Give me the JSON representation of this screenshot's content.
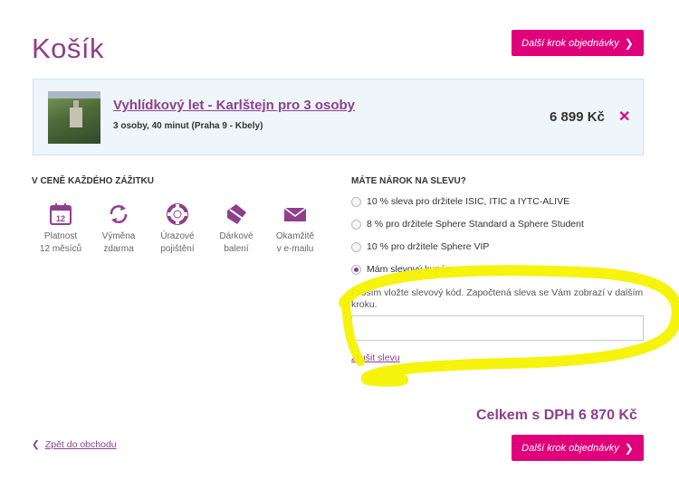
{
  "page": {
    "title": "Košík"
  },
  "actions": {
    "next_label": "Další krok objednávky",
    "next_chevron": "❯",
    "back_chevron": "❮",
    "back_label": "Zpět do obchodu"
  },
  "item": {
    "title": "Vyhlídkový let - Karlštejn pro 3 osoby",
    "subtitle": "3 osoby, 40 minut  (Praha 9 - Kbely)",
    "price": "6 899 Kč",
    "remove": "✕"
  },
  "benefits": {
    "heading": "V CENĚ KAŽDÉHO ZÁŽITKU",
    "items": [
      {
        "icon": "calendar-icon",
        "calendar_number": "12",
        "line1": "Platnost",
        "line2": "12 měsíců"
      },
      {
        "icon": "exchange-icon",
        "line1": "Výměna",
        "line2": "zdarma"
      },
      {
        "icon": "lifebuoy-icon",
        "line1": "Úrazové",
        "line2": "pojištění"
      },
      {
        "icon": "gift-box-icon",
        "line1": "Dárkové",
        "line2": "balení"
      },
      {
        "icon": "envelope-icon",
        "line1": "Okamžitě",
        "line2": "v e-mailu"
      }
    ]
  },
  "discount": {
    "heading": "MÁTE NÁROK NA SLEVU?",
    "options": [
      {
        "label": "10 % sleva pro držitele ISIC, ITIC a IYTC-ALIVE",
        "selected": false
      },
      {
        "label": "8 % pro držitele Sphere Standard a Sphere Student",
        "selected": false
      },
      {
        "label": "10 % pro držitele Sphere VIP",
        "selected": false
      },
      {
        "label": "Mám slevový kupón",
        "selected": true
      }
    ],
    "coupon_hint": "Prosím vložte slevový kód. Započtená sleva se Vám zobrazí v dalším kroku.",
    "coupon_value": "",
    "cancel_label": "Zrušit slevu"
  },
  "summary": {
    "total": "Celkem s DPH 6 870 Kč"
  },
  "colors": {
    "accent": "#8f3f8c",
    "cta": "#e0007a",
    "highlight": "#f5f200"
  }
}
